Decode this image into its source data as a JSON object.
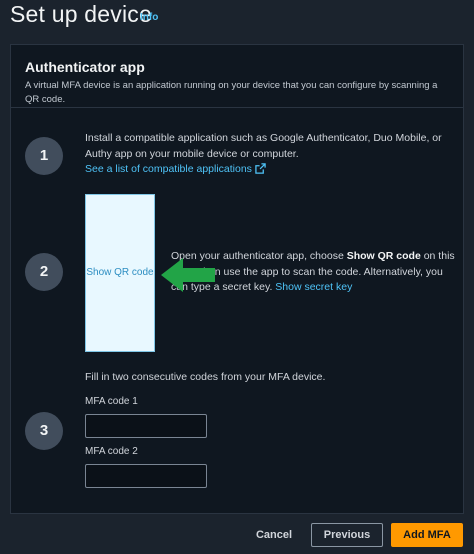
{
  "header": {
    "title": "Set up device",
    "info": "Info"
  },
  "panel": {
    "title": "Authenticator app",
    "description": "A virtual MFA device is an application running on your device that you can configure by scanning a QR code."
  },
  "steps": [
    {
      "number": "1",
      "text": "Install a compatible application such as Google Authenticator, Duo Mobile, or Authy app on your mobile device or computer.",
      "link": "See a list of compatible applications"
    },
    {
      "number": "2",
      "text_before": "Open your authenticator app, choose ",
      "bold": "Show QR code",
      "text_after": " on this page, then use the app to scan the code. Alternatively, you can type a secret key. ",
      "link": "Show secret key",
      "qr_label": "Show QR code"
    },
    {
      "number": "3",
      "text": "Fill in two consecutive codes from your MFA device.",
      "field1_label": "MFA code 1",
      "field1_value": "",
      "field2_label": "MFA code 2",
      "field2_value": ""
    }
  ],
  "footer": {
    "cancel": "Cancel",
    "previous": "Previous",
    "add": "Add MFA"
  },
  "colors": {
    "accent": "#ff9900",
    "link": "#4fc3f7",
    "arrow": "#22a447"
  },
  "icons": {
    "external_link": "external-link-icon",
    "arrow": "arrow-left-icon"
  }
}
